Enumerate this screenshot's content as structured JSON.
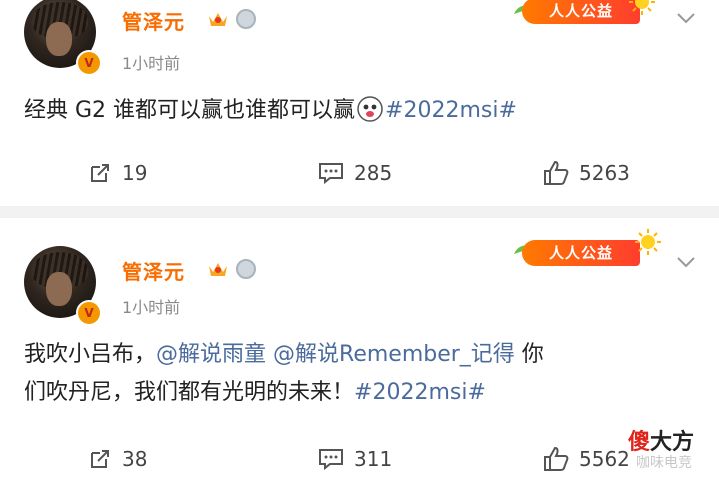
{
  "posts": [
    {
      "username": "管泽元",
      "time": "1小时前",
      "badge_label": "人人公益",
      "verified_mark": "V",
      "content": [
        {
          "type": "text",
          "text": "经典 G2 谁都可以赢也谁都可以赢"
        },
        {
          "type": "emoji",
          "icon": "laughing-face-emoji-icon"
        },
        {
          "type": "hashtag",
          "text": "#2022msi#"
        }
      ],
      "reposts": "19",
      "comments": "285",
      "likes": "5263"
    },
    {
      "username": "管泽元",
      "time": "1小时前",
      "badge_label": "人人公益",
      "verified_mark": "V",
      "content_line1_a": "我吹小吕布，",
      "mention1": "@解说雨童",
      "mention2": "@解说Remember_记得",
      "content_line1_b": " 你",
      "content_line2_a": "们吹丹尼，我们都有光明的未来！",
      "hashtag": "#2022msi#",
      "reposts": "38",
      "comments": "311",
      "likes": "5562"
    }
  ],
  "watermark": {
    "char1": "傻",
    "rest": "大方",
    "faint": "咖味电竞"
  },
  "colors": {
    "username": "#f86c00",
    "link": "#4b6b9c",
    "background": "#f2f2f2"
  },
  "icons": [
    "repost-icon",
    "comment-icon",
    "like-icon",
    "chevron-down-icon",
    "crown-icon",
    "medal-icon",
    "sun-icon"
  ]
}
